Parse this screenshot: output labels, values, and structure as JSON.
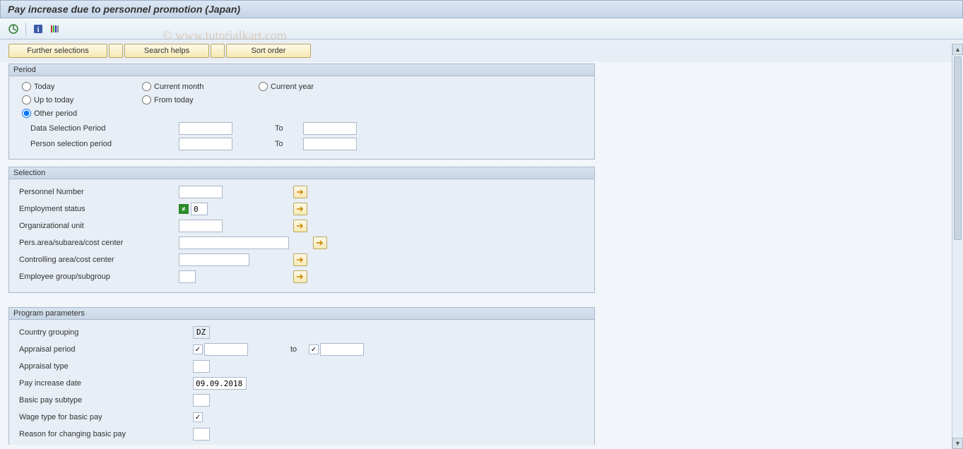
{
  "title": "Pay increase due to personnel promotion (Japan)",
  "watermark": "© www.tutorialkart.com",
  "buttons": {
    "further_selections": "Further selections",
    "search_helps": "Search helps",
    "sort_order": "Sort order"
  },
  "groups": {
    "period": {
      "title": "Period",
      "radios": {
        "today": "Today",
        "current_month": "Current month",
        "current_year": "Current year",
        "up_to_today": "Up to today",
        "from_today": "From today",
        "other_period": "Other period"
      },
      "selected": "other_period",
      "data_selection_label": "Data Selection Period",
      "person_selection_label": "Person selection period",
      "to": "To"
    },
    "selection": {
      "title": "Selection",
      "personnel_number": "Personnel Number",
      "employment_status": "Employment status",
      "employment_status_value": "0",
      "org_unit": "Organizational unit",
      "pers_area": "Pers.area/subarea/cost center",
      "controlling_area": "Controlling area/cost center",
      "employee_group": "Employee group/subgroup"
    },
    "params": {
      "title": "Program parameters",
      "country_grouping": "Country grouping",
      "country_grouping_value": "DZ",
      "appraisal_period": "Appraisal period",
      "appraisal_period_checked": true,
      "to": "to",
      "to_checked": true,
      "appraisal_type": "Appraisal type",
      "pay_increase_date": "Pay increase date",
      "pay_increase_date_value": "09.09.2018",
      "basic_pay_subtype": "Basic pay subtype",
      "wage_type": "Wage type for basic pay",
      "wage_type_checked": true,
      "reason": "Reason for changing basic pay"
    }
  }
}
